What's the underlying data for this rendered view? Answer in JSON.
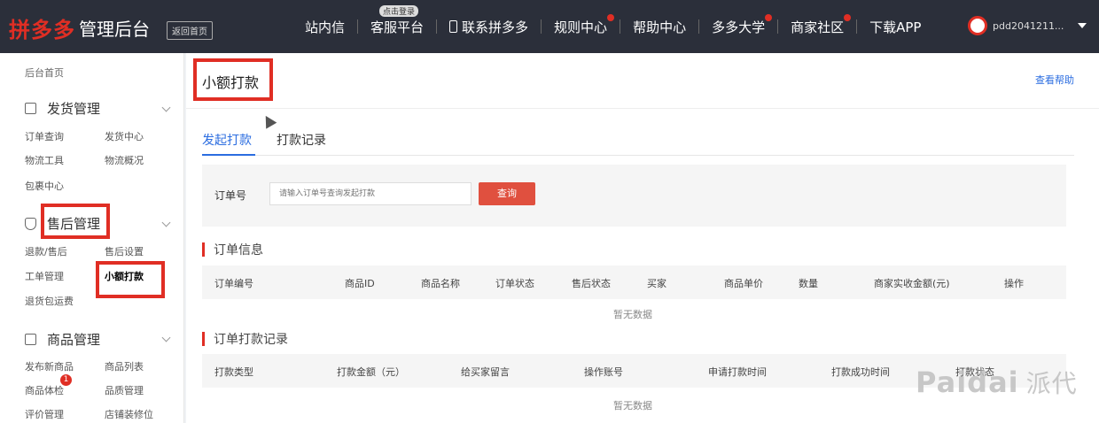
{
  "topbar": {
    "brand": "拼多多",
    "title": "管理后台",
    "home_label": "返回首页",
    "nav": [
      {
        "label": "站内信",
        "dot": false,
        "tag": ""
      },
      {
        "label": "客服平台",
        "dot": false,
        "tag": "点击登录"
      },
      {
        "label": "联系拼多多",
        "dot": false,
        "tag": "",
        "icon": "phone-icon"
      },
      {
        "label": "规则中心",
        "dot": true,
        "tag": ""
      },
      {
        "label": "帮助中心",
        "dot": false,
        "tag": ""
      },
      {
        "label": "多多大学",
        "dot": true,
        "tag": ""
      },
      {
        "label": "商家社区",
        "dot": true,
        "tag": ""
      },
      {
        "label": "下载APP",
        "dot": false,
        "tag": ""
      }
    ],
    "username": "pdd2041211..."
  },
  "sidebar": {
    "home": "后台首页",
    "groups": [
      {
        "label": "发货管理",
        "icon": "document-icon"
      },
      {
        "label": "售后管理",
        "icon": "shield-icon"
      },
      {
        "label": "商品管理",
        "icon": "box-icon"
      }
    ],
    "links": {
      "order_query": "订单查询",
      "shipping_center": "发货中心",
      "shipping_tools": "物流工具",
      "logistics_overview": "物流概况",
      "eval_center": "包裹中心",
      "refund": "退款/售后",
      "after_sales_settings": "售后设置",
      "work_order": "工单管理",
      "small_payment": "小额打款",
      "return_address": "退货包运费",
      "publish_goods": "发布新商品",
      "goods_list": "商品列表",
      "goods_health": "商品体检",
      "goods_quality": "品质管理",
      "review_manage": "评价管理",
      "store_decor": "店铺装修位"
    },
    "badge_count": "1"
  },
  "main": {
    "title": "小额打款",
    "help_link": "查看帮助",
    "tabs": [
      "发起打款",
      "打款记录"
    ],
    "search": {
      "label": "订单号",
      "placeholder": "请输入订单号查询发起打款",
      "button": "查询"
    },
    "order_info": {
      "title": "订单信息",
      "columns": [
        "订单编号",
        "商品ID",
        "商品名称",
        "订单状态",
        "售后状态",
        "买家",
        "商品单价",
        "数量",
        "商家实收金额(元)",
        "操作"
      ],
      "empty": "暂无数据"
    },
    "payment_records": {
      "title": "订单打款记录",
      "columns": [
        "打款类型",
        "打款金额（元）",
        "给买家留言",
        "操作账号",
        "申请打款时间",
        "打款成功时间",
        "打款状态"
      ],
      "empty": "暂无数据"
    }
  },
  "watermark": {
    "latin": "Paidai",
    "cn": "派代"
  }
}
